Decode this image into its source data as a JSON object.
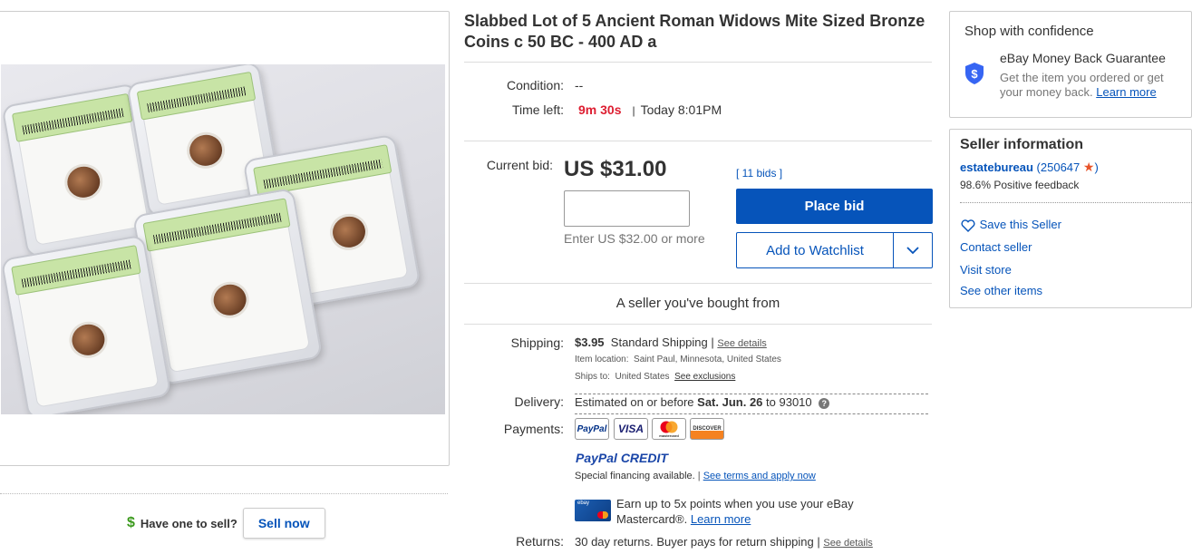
{
  "listing": {
    "title": "Slabbed Lot of 5 Ancient Roman Widows Mite Sized Bronze Coins c 50 BC - 400 AD a",
    "condition_label": "Condition:",
    "condition_value": "--",
    "time_left_label": "Time left:",
    "time_left_value": "9m 30s",
    "end_time": "Today 8:01PM"
  },
  "bid": {
    "current_label": "Current bid:",
    "price": "US $31.00",
    "bids_link": "[ 11 bids ]",
    "input_placeholder": "",
    "hint": "Enter US $32.00 or more",
    "place_bid": "Place bid",
    "watchlist": "Add to Watchlist"
  },
  "seller_note": "A seller you've bought from",
  "shipping": {
    "label": "Shipping:",
    "price": "$3.95",
    "method": "Standard Shipping |",
    "details_link": "See details",
    "location_label": "Item location:",
    "location": "Saint Paul, Minnesota, United States",
    "ships_to_label": "Ships to:",
    "ships_to": "United States",
    "exclusions_link": "See exclusions"
  },
  "delivery": {
    "label": "Delivery:",
    "text": "Estimated on or before",
    "date": "Sat. Jun. 26",
    "to": "to 93010"
  },
  "payments": {
    "label": "Payments:",
    "badges": [
      "PayPal",
      "VISA",
      "mastercard",
      "DISCOVER"
    ],
    "paypal_credit": "PayPal CREDIT",
    "financing": "Special financing available.",
    "financing_sep": "|",
    "financing_link": "See terms and apply now",
    "mc_text": "Earn up to 5x points when you use your eBay Mastercard®.",
    "mc_link": "Learn more"
  },
  "returns": {
    "label": "Returns:",
    "text": "30 day returns. Buyer pays for return shipping |",
    "link": "See details"
  },
  "sell": {
    "question": "Have one to sell?",
    "button": "Sell now"
  },
  "confidence": {
    "title": "Shop with confidence",
    "mbg_title": "eBay Money Back Guarantee",
    "mbg_text": "Get the item you ordered or get your money back.",
    "mbg_link": "Learn more"
  },
  "seller": {
    "heading": "Seller information",
    "name": "estatebureau",
    "score": "250647",
    "feedback": "98.6% Positive feedback",
    "save": "Save this Seller",
    "contact": "Contact seller",
    "store": "Visit store",
    "other": "See other items"
  },
  "colors": {
    "link": "#0654ba",
    "timer": "#dd1e31",
    "primary_button": "#0654ba"
  }
}
